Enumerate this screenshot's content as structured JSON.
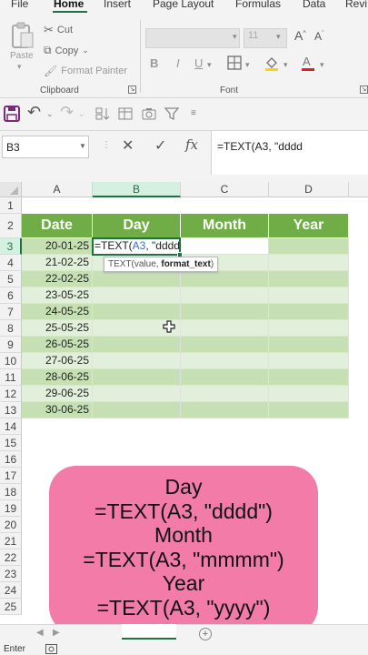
{
  "ribbon": {
    "tabs": [
      "File",
      "Home",
      "Insert",
      "Page Layout",
      "Formulas",
      "Data",
      "Revi"
    ],
    "active_tab": "Home",
    "clipboard": {
      "paste_label": "Paste",
      "cut_label": "Cut",
      "copy_label": "Copy",
      "format_painter_label": "Format Painter",
      "group_label": "Clipboard"
    },
    "font": {
      "size_value": "11",
      "group_label": "Font"
    }
  },
  "formula_bar": {
    "name_box": "B3",
    "formula": "=TEXT(A3, \"dddd"
  },
  "sheet": {
    "columns": [
      "A",
      "B",
      "C",
      "D"
    ],
    "row_numbers": [
      "1",
      "2",
      "3",
      "4",
      "5",
      "6",
      "7",
      "8",
      "9",
      "10",
      "11",
      "12",
      "13",
      "14",
      "15",
      "16",
      "17",
      "18",
      "19",
      "20",
      "21",
      "22",
      "23",
      "24",
      "25"
    ],
    "headers": [
      "Date",
      "Day",
      "Month",
      "Year"
    ],
    "dates": [
      "20-01-25",
      "21-02-25",
      "22-02-25",
      "23-05-25",
      "24-05-25",
      "25-05-25",
      "26-05-25",
      "27-06-25",
      "28-06-25",
      "29-06-25",
      "30-06-25"
    ],
    "active_cell": {
      "prefix": "=TEXT(",
      "ref": "A3",
      "suffix": ", \"dddd"
    },
    "tooltip": {
      "text": "TEXT(value, ",
      "bold": "format_text",
      "close": ")"
    }
  },
  "overlay": {
    "lines": [
      "Day",
      "=TEXT(A3, \"dddd\")",
      "Month",
      "=TEXT(A3, \"mmmm\")",
      "Year",
      "=TEXT(A3, \"yyyy\")"
    ]
  },
  "status": {
    "mode": "Enter"
  },
  "colors": {
    "header_fill": "#70ad47",
    "band_dark": "#c6e0b4",
    "band_light": "#e2efda",
    "accent": "#1e7145",
    "overlay": "#f27ba8"
  }
}
